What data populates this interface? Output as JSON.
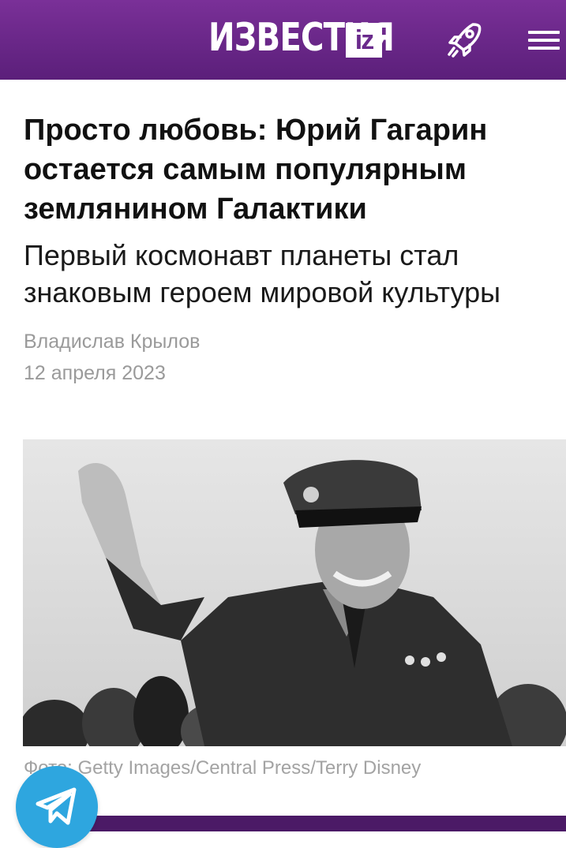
{
  "header": {
    "logo_text": "ИЗВЕСТИЯ",
    "logo_badge": "iz",
    "icons": [
      "rocket-icon",
      "menu-icon"
    ],
    "colors": {
      "header_top": "#7a3098",
      "header_bottom": "#5b1f7a"
    }
  },
  "article": {
    "title": "Просто любовь: Юрий Гагарин остается самым популярным землянином Галактики",
    "subtitle": "Первый космонавт планеты стал знаковым героем мировой культуры",
    "author": "Владислав Крылов",
    "date": "12 апреля 2023",
    "photo_caption": "Фото: Getty Images/Central Press/Terry Disney"
  },
  "share": {
    "telegram_icon": "telegram-icon",
    "color": "#2ea6df"
  }
}
